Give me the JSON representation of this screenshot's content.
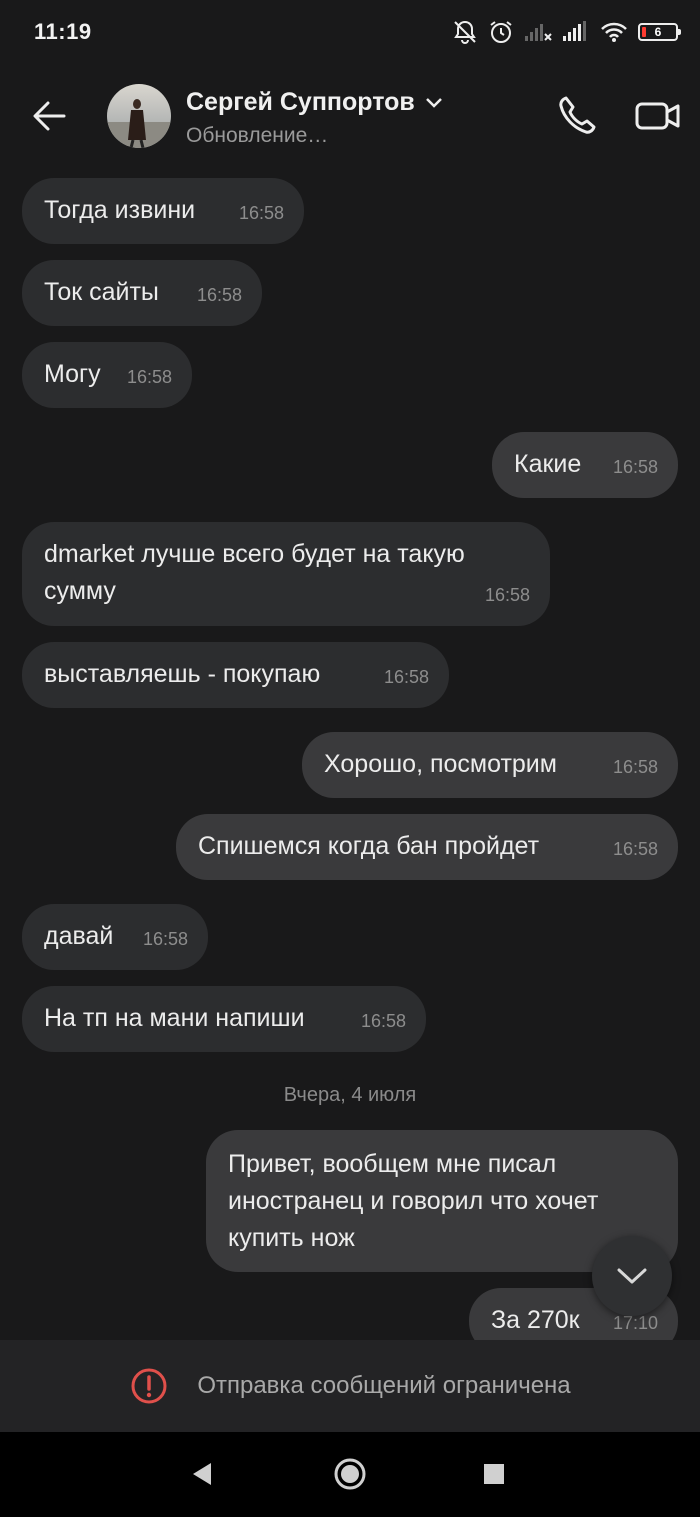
{
  "status_bar": {
    "time": "11:19",
    "battery_level": "6"
  },
  "header": {
    "contact_name": "Сергей Суппортов",
    "status": "Обновление…"
  },
  "messages": [
    {
      "text": "Тогда извини",
      "time": "16:58",
      "direction": "in"
    },
    {
      "text": "Ток сайты",
      "time": "16:58",
      "direction": "in"
    },
    {
      "text": "Могу",
      "time": "16:58",
      "direction": "in"
    },
    {
      "text": "Какие",
      "time": "16:58",
      "direction": "out"
    },
    {
      "text": "dmarket лучше всего будет на такую сумму",
      "time": "16:58",
      "direction": "in"
    },
    {
      "text": "выставляешь - покупаю",
      "time": "16:58",
      "direction": "in"
    },
    {
      "text": "Хорошо, посмотрим",
      "time": "16:58",
      "direction": "out"
    },
    {
      "text": "Спишемся когда бан пройдет",
      "time": "16:58",
      "direction": "out"
    },
    {
      "text": "давай",
      "time": "16:58",
      "direction": "in"
    },
    {
      "text": "На тп на мани напиши",
      "time": "16:58",
      "direction": "in"
    },
    {
      "text": "Привет, вообщем мне писал иностранец и говорил что хочет купить нож",
      "time": "",
      "direction": "out"
    },
    {
      "text": "За 270к",
      "time": "17:10",
      "direction": "out"
    }
  ],
  "date_separator": "Вчера, 4 июля",
  "restricted_notice": "Отправка сообщений ограничена",
  "colors": {
    "background": "#19191a",
    "incoming_bubble": "#2c2d2f",
    "outgoing_bubble": "#3a3a3c",
    "warning": "#e0504b"
  }
}
